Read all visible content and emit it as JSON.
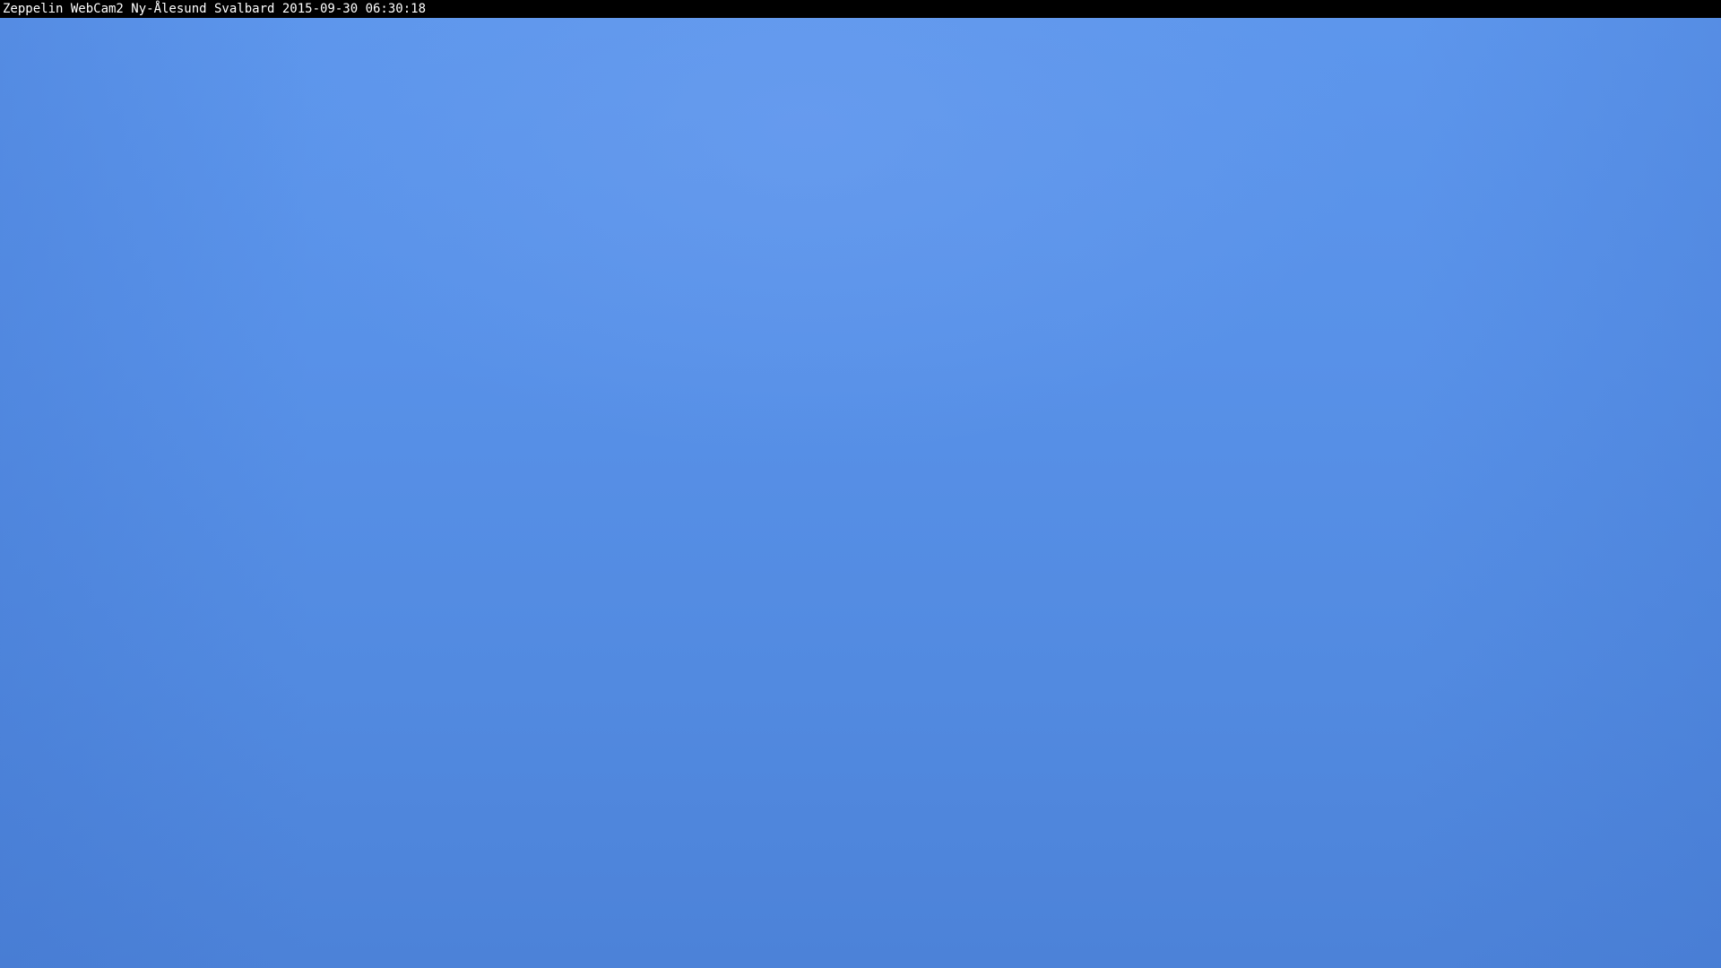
{
  "webcam": {
    "caption": "Zeppelin WebCam2 Ny-Ålesund Svalbard 2015-09-30 06:30:18"
  },
  "colors": {
    "caption_background": "#000000",
    "caption_text": "#ffffff",
    "sky_top": "#5d96ec",
    "sky_bottom": "#4c82d8"
  }
}
